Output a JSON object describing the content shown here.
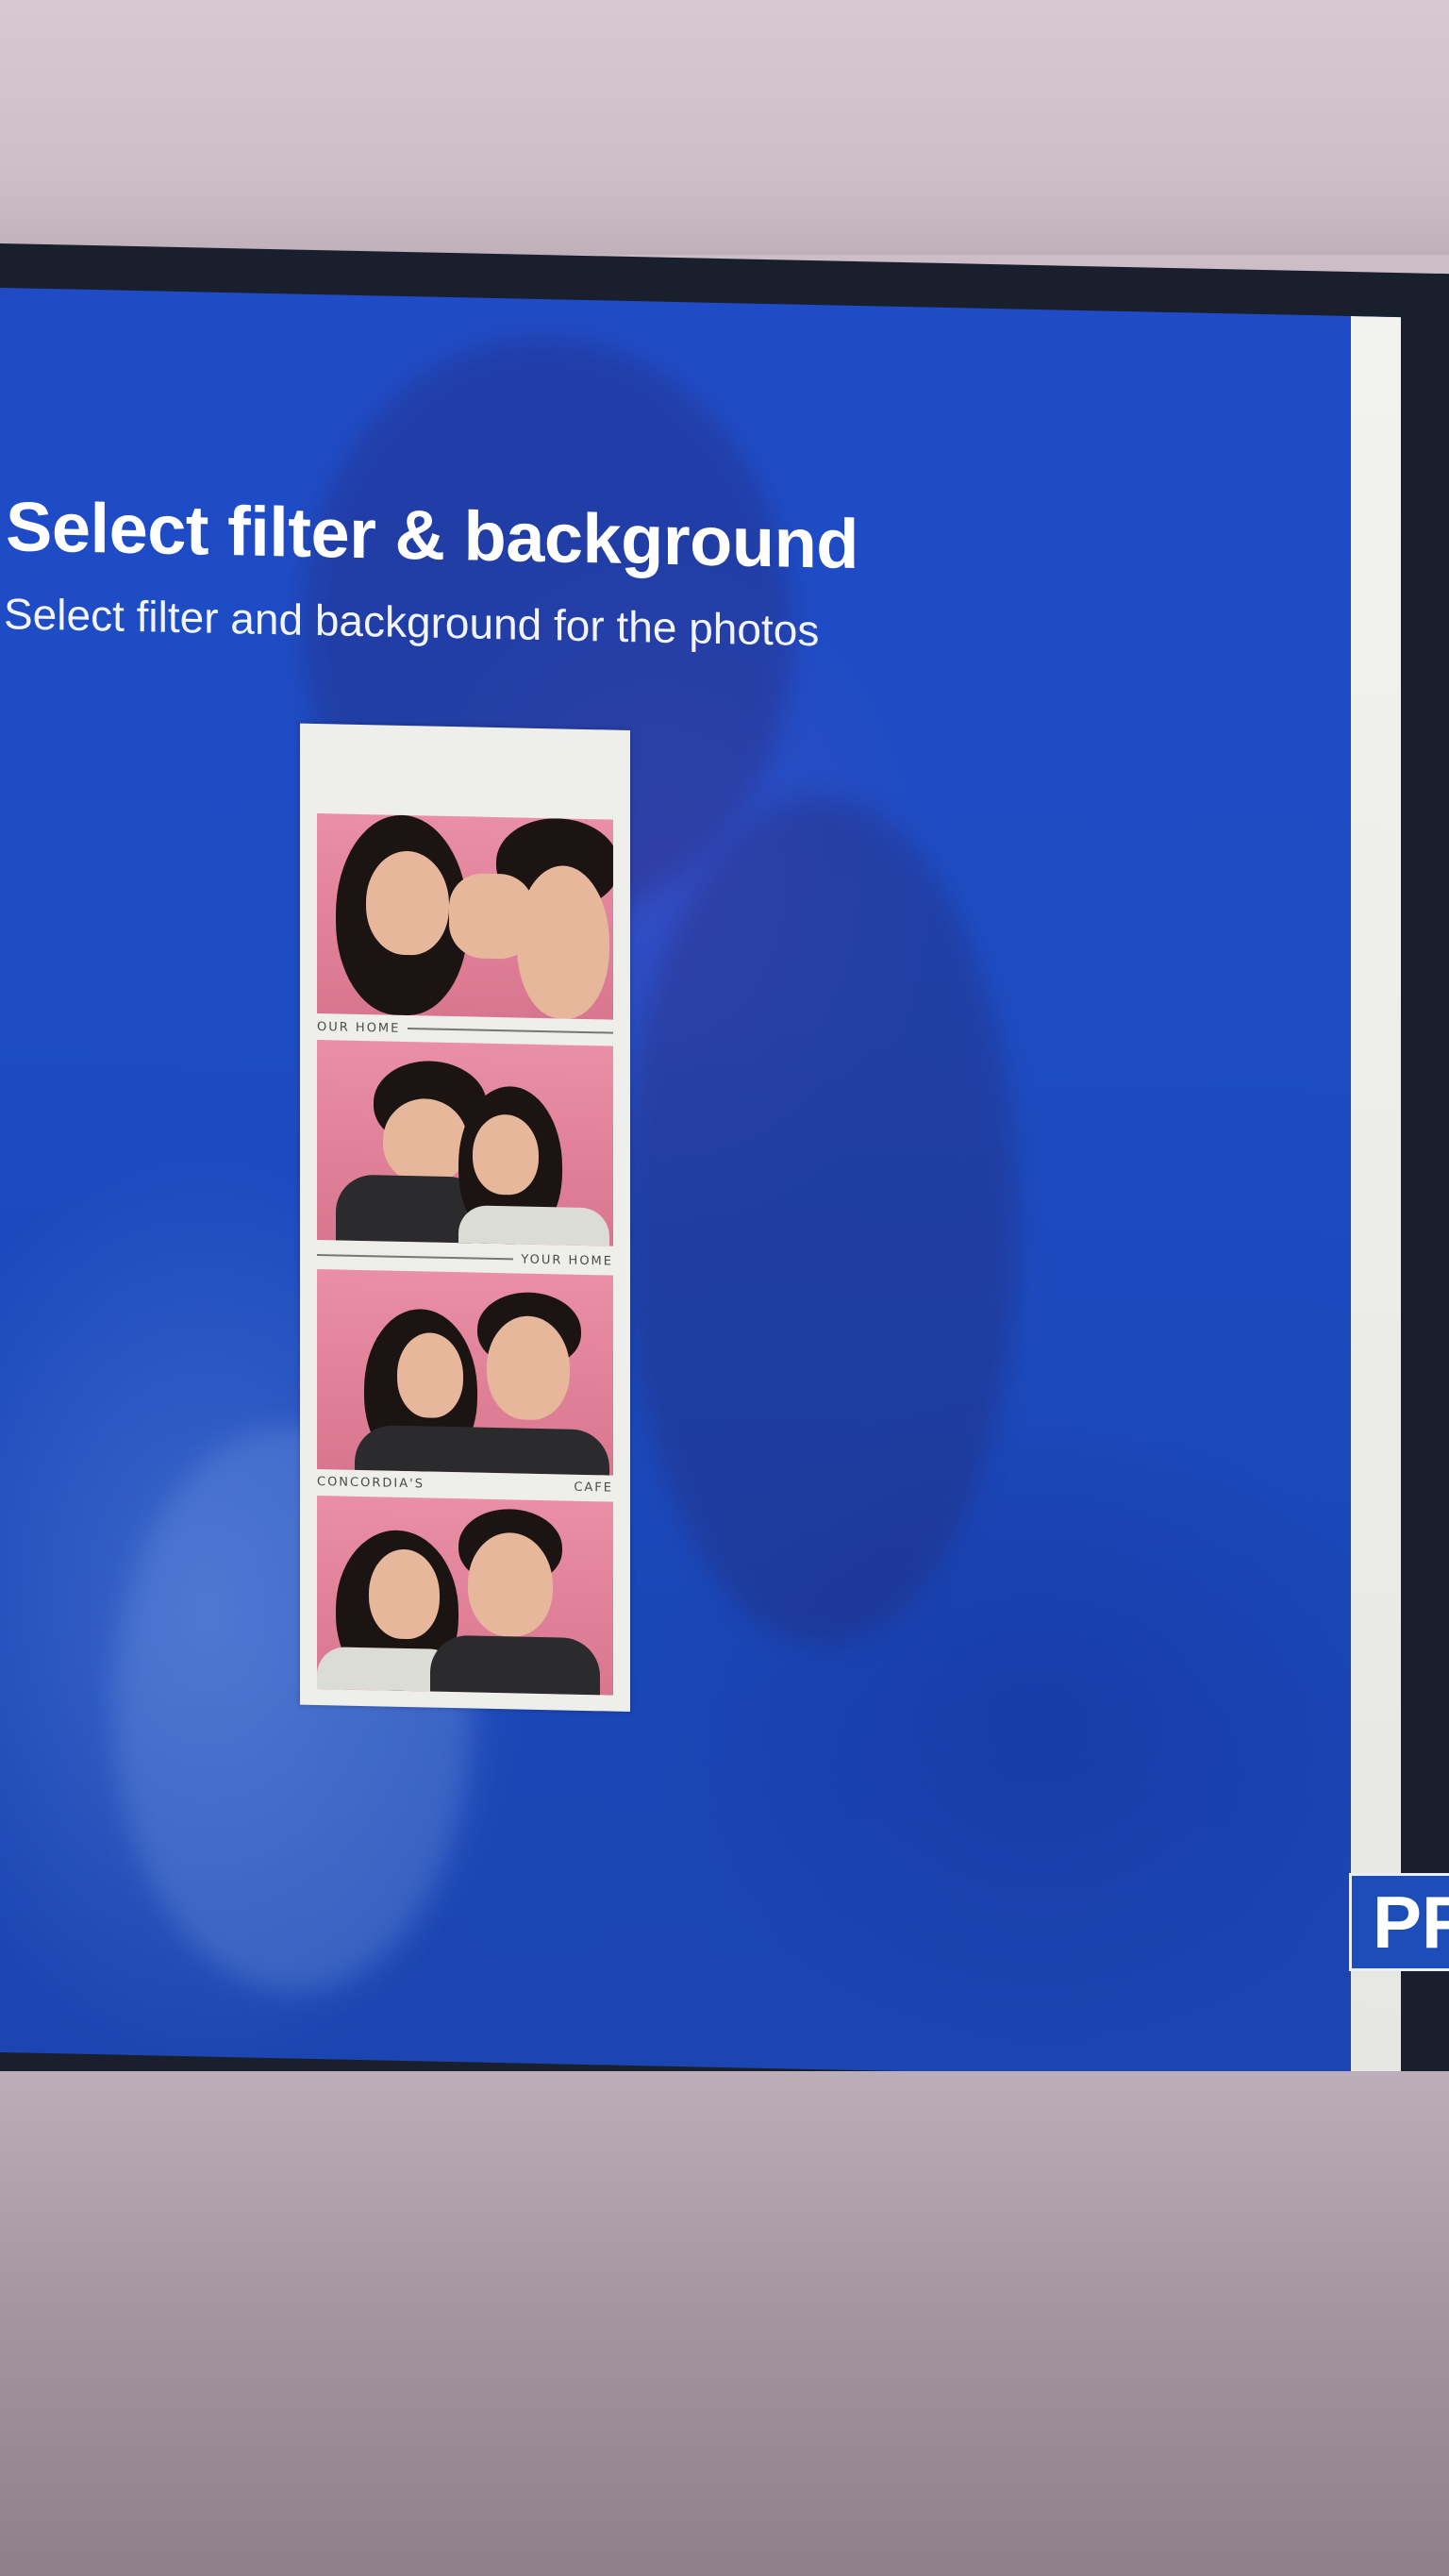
{
  "header": {
    "title": "Select filter & background",
    "subtitle": "Select filter and background for the photos"
  },
  "photo_strip": {
    "captions": [
      {
        "left": "OUR HOME",
        "right": ""
      },
      {
        "left": "",
        "right": "YOUR HOME"
      },
      {
        "left": "CONCORDIA'S",
        "right": "CAFE"
      }
    ],
    "photo_background_color": "#e48aa3"
  },
  "actions": {
    "next_button_label": "PF"
  },
  "colors": {
    "screen_blue": "#1d4cc2",
    "button_blue": "#1d4db8"
  }
}
